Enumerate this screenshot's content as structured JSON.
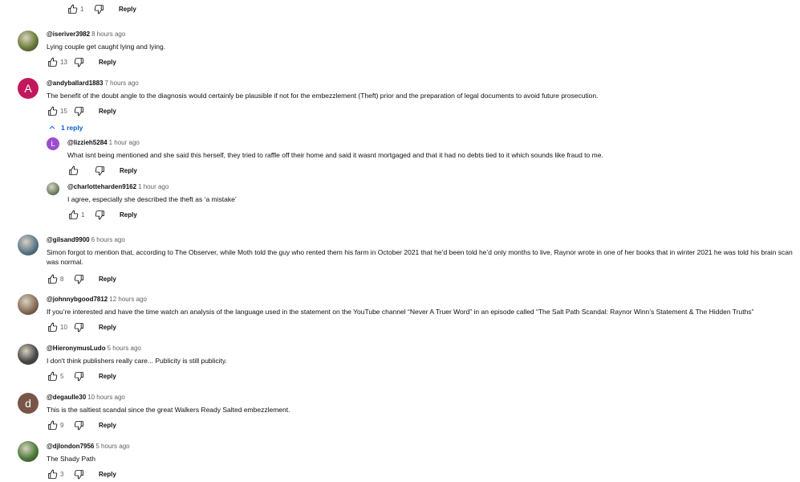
{
  "top_actions": {
    "likes": "1",
    "reply_label": "Reply"
  },
  "replies_toggle": {
    "label": "1 reply"
  },
  "comments": [
    {
      "handle": "@iseriver3982",
      "time": "8 hours ago",
      "text": "Lying couple get caught lying and lying.",
      "likes": "13",
      "reply_label": "Reply",
      "avatar": {
        "type": "image",
        "color": "#6b7f3a"
      }
    },
    {
      "handle": "@andyballard1883",
      "time": "7 hours ago",
      "text": "The benefit of the doubt angle to the diagnosis would certainly be plausible if not for the embezzlement (Theft) prior and the preparation of legal documents to avoid future prosecution.",
      "likes": "15",
      "reply_label": "Reply",
      "avatar": {
        "type": "letter",
        "letter": "A",
        "color": "#c2185b"
      }
    },
    {
      "handle": "@lizzieh5284",
      "time": "1 hour ago",
      "text": "What isnt being mentioned and she said this herself, they tried to  raffle off their home and said it wasnt mortgaged and that it had no debts tied to it which sounds like fraud to me.",
      "likes": "",
      "reply_label": "Reply",
      "avatar": {
        "type": "letter",
        "letter": "L",
        "color": "#9c4dcc"
      }
    },
    {
      "handle": "@charlotteharden9162",
      "time": "1 hour ago",
      "text": "I agree, especially she described the theft as ‘a mistake’",
      "likes": "1",
      "reply_label": "Reply",
      "avatar": {
        "type": "image",
        "color": "#7a8a6e"
      }
    },
    {
      "handle": "@gilsand9900",
      "time": "6 hours ago",
      "text": "Simon forgot to mention that, according to The Observer, while Moth told the guy who rented them his farm in October 2021 that he’d been told he’d only months to live, Raynor wrote in one of her books that in winter 2021 he was told his brain scan was normal.",
      "likes": "8",
      "reply_label": "Reply",
      "avatar": {
        "type": "image",
        "color": "#5f7a8c"
      }
    },
    {
      "handle": "@johnnybgood7812",
      "time": "12 hours ago",
      "text": "If you’re interested and have the time watch an analysis of the language used in the statement on the YouTube channel “Never A Truer Word” in an episode called “The Salt Path Scandal: Raynor Winn’s Statement & The Hidden Truths”",
      "likes": "10",
      "reply_label": "Reply",
      "avatar": {
        "type": "image",
        "color": "#8a6f5a"
      }
    },
    {
      "handle": "@HieronymusLudo",
      "time": "5 hours ago",
      "text": "I don't think publishers really care... Publicity is still publicity.",
      "likes": "5",
      "reply_label": "Reply",
      "avatar": {
        "type": "image",
        "color": "#4a4a4a"
      }
    },
    {
      "handle": "@degaulle30",
      "time": "10 hours ago",
      "text": "This is the saltiest scandal since the great Walkers Ready Salted embezzlement.",
      "likes": "9",
      "reply_label": "Reply",
      "avatar": {
        "type": "letter",
        "letter": "d",
        "color": "#795548"
      }
    },
    {
      "handle": "@djlondon7956",
      "time": "5 hours ago",
      "text": "The Shady Path",
      "likes": "3",
      "reply_label": "Reply",
      "avatar": {
        "type": "image",
        "color": "#4e7d3a"
      }
    }
  ]
}
